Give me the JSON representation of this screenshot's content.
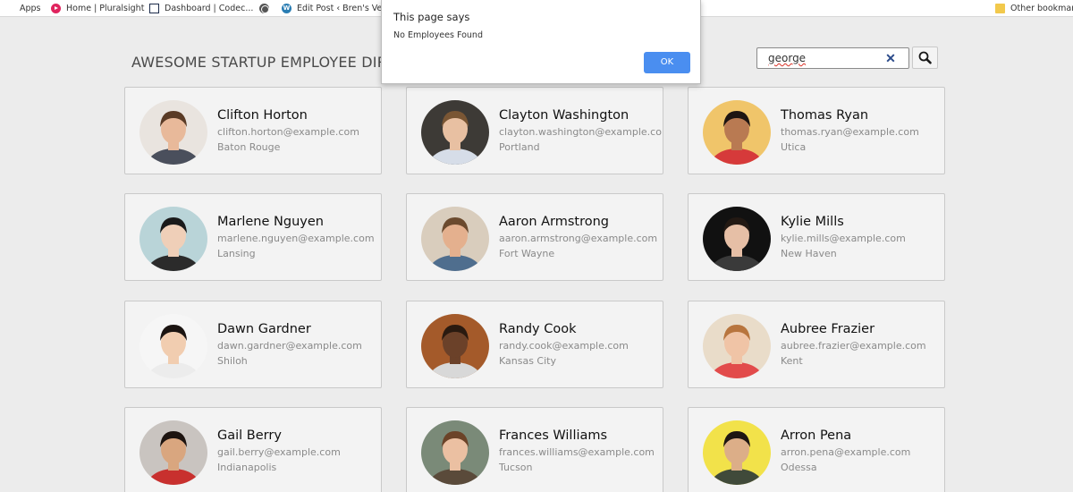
{
  "bookmarks": {
    "apps": "Apps",
    "pluralsight": "Home | Pluralsight",
    "codecademy": "Dashboard | Codec...",
    "edit_post": "Edit Post ‹ Bren's Ve...",
    "other": "Other bookmarks"
  },
  "page": {
    "title": "AWESOME STARTUP EMPLOYEE DIRECTORY"
  },
  "search": {
    "value": "george"
  },
  "dialog": {
    "title": "This page says",
    "message": "No Employees Found",
    "ok_label": "OK"
  },
  "employees": [
    {
      "name": "Clifton Horton",
      "email": "clifton.horton@example.com",
      "city": "Baton Rouge",
      "photo": {
        "bg": "#e9e4df",
        "skin": "#e8b99a",
        "hair": "#5a3b26",
        "shirt": "#4a4f5c"
      }
    },
    {
      "name": "Clayton Washington",
      "email": "clayton.washington@example.com",
      "city": "Portland",
      "photo": {
        "bg": "#3d3a36",
        "skin": "#e8c0a2",
        "hair": "#7a5634",
        "shirt": "#d6dde8"
      }
    },
    {
      "name": "Thomas Ryan",
      "email": "thomas.ryan@example.com",
      "city": "Utica",
      "photo": {
        "bg": "#f0c56a",
        "skin": "#b97a52",
        "hair": "#1e1512",
        "shirt": "#d63a3a"
      }
    },
    {
      "name": "Marlene Nguyen",
      "email": "marlene.nguyen@example.com",
      "city": "Lansing",
      "photo": {
        "bg": "#b9d4d8",
        "skin": "#efcfb8",
        "hair": "#1a1a1a",
        "shirt": "#2b2b2b"
      }
    },
    {
      "name": "Aaron Armstrong",
      "email": "aaron.armstrong@example.com",
      "city": "Fort Wayne",
      "photo": {
        "bg": "#d9cdbd",
        "skin": "#e4b08e",
        "hair": "#6b4a2e",
        "shirt": "#4f6e8e"
      }
    },
    {
      "name": "Kylie Mills",
      "email": "kylie.mills@example.com",
      "city": "New Haven",
      "photo": {
        "bg": "#111111",
        "skin": "#e6bfa6",
        "hair": "#231913",
        "shirt": "#3a3a3a"
      }
    },
    {
      "name": "Dawn Gardner",
      "email": "dawn.gardner@example.com",
      "city": "Shiloh",
      "photo": {
        "bg": "#f6f6f6",
        "skin": "#f1cdb0",
        "hair": "#1b1411",
        "shirt": "#ececec"
      }
    },
    {
      "name": "Randy Cook",
      "email": "randy.cook@example.com",
      "city": "Kansas City",
      "photo": {
        "bg": "#a45a2a",
        "skin": "#6b4129",
        "hair": "#2a1a10",
        "shirt": "#d8d8d8"
      }
    },
    {
      "name": "Aubree Frazier",
      "email": "aubree.frazier@example.com",
      "city": "Kent",
      "photo": {
        "bg": "#e9dcc9",
        "skin": "#f0c4a6",
        "hair": "#b8753e",
        "shirt": "#e24b4b"
      }
    },
    {
      "name": "Gail Berry",
      "email": "gail.berry@example.com",
      "city": "Indianapolis",
      "photo": {
        "bg": "#c9c4c0",
        "skin": "#d9a67f",
        "hair": "#1d1410",
        "shirt": "#c8302e"
      }
    },
    {
      "name": "Frances Williams",
      "email": "frances.williams@example.com",
      "city": "Tucson",
      "photo": {
        "bg": "#7a8a78",
        "skin": "#ebc0a2",
        "hair": "#6b4328",
        "shirt": "#5a4a3a"
      }
    },
    {
      "name": "Arron Pena",
      "email": "arron.pena@example.com",
      "city": "Odessa",
      "photo": {
        "bg": "#f2e24a",
        "skin": "#dcae88",
        "hair": "#1e1612",
        "shirt": "#404a3a"
      }
    }
  ]
}
